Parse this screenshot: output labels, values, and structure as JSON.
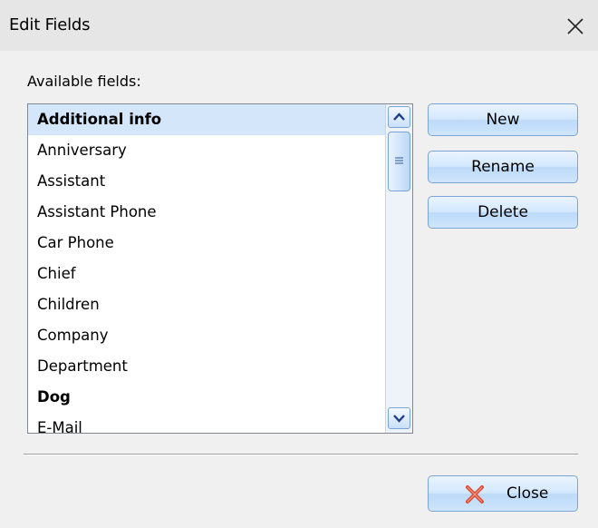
{
  "window": {
    "title": "Edit Fields",
    "close_icon": "close-icon"
  },
  "available_label": "Available fields:",
  "fields": [
    {
      "label": "Additional info",
      "bold": true,
      "selected": true
    },
    {
      "label": "Anniversary",
      "bold": false,
      "selected": false
    },
    {
      "label": "Assistant",
      "bold": false,
      "selected": false
    },
    {
      "label": "Assistant Phone",
      "bold": false,
      "selected": false
    },
    {
      "label": "Car Phone",
      "bold": false,
      "selected": false
    },
    {
      "label": "Chief",
      "bold": false,
      "selected": false
    },
    {
      "label": "Children",
      "bold": false,
      "selected": false
    },
    {
      "label": "Company",
      "bold": false,
      "selected": false
    },
    {
      "label": "Department",
      "bold": false,
      "selected": false
    },
    {
      "label": "Dog",
      "bold": true,
      "selected": false
    },
    {
      "label": "E-Mail",
      "bold": false,
      "selected": false
    }
  ],
  "buttons": {
    "new": "New",
    "rename": "Rename",
    "delete": "Delete",
    "close": "Close"
  },
  "icons": {
    "scroll_up": "chevron-up-icon",
    "scroll_down": "chevron-down-icon",
    "scroll_grip": "grip-icon",
    "close_button": "red-x-icon"
  },
  "colors": {
    "title_bar": "#e6e6e6",
    "selection": "#d4e7fa",
    "button_border": "#7aa4d6",
    "close_x": "#e0452b"
  }
}
